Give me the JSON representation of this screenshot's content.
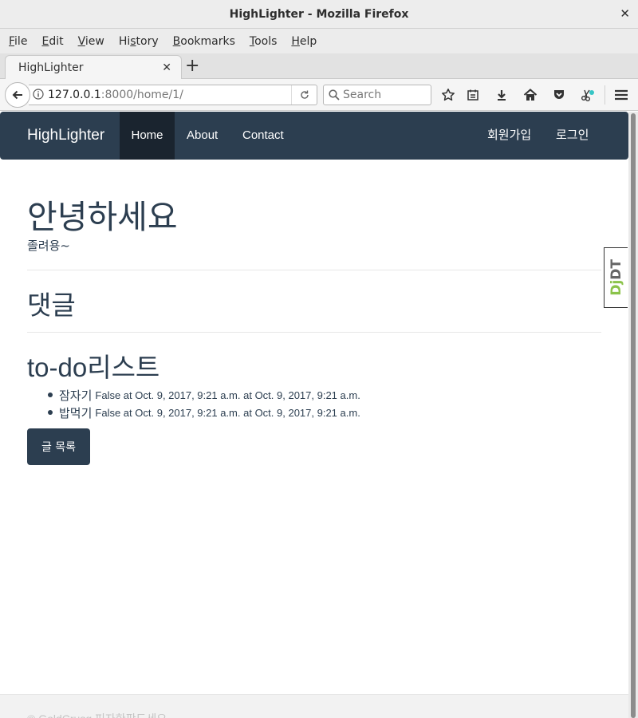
{
  "window": {
    "title": "HighLighter - Mozilla Firefox"
  },
  "menu": {
    "items": [
      {
        "label_pre": "",
        "label_u": "F",
        "label_post": "ile"
      },
      {
        "label_pre": "",
        "label_u": "E",
        "label_post": "dit"
      },
      {
        "label_pre": "",
        "label_u": "V",
        "label_post": "iew"
      },
      {
        "label_pre": "Hi",
        "label_u": "s",
        "label_post": "tory"
      },
      {
        "label_pre": "",
        "label_u": "B",
        "label_post": "ookmarks"
      },
      {
        "label_pre": "",
        "label_u": "T",
        "label_post": "ools"
      },
      {
        "label_pre": "",
        "label_u": "H",
        "label_post": "elp"
      }
    ]
  },
  "tab": {
    "title": "HighLighter"
  },
  "urlbar": {
    "host": "127.0.0.1",
    "rest": ":8000/home/1/"
  },
  "search": {
    "placeholder": "Search"
  },
  "site": {
    "brand": "HighLighter",
    "nav": {
      "home": "Home",
      "about": "About",
      "contact": "Contact",
      "signup": "회원가입",
      "login": "로그인"
    },
    "greeting": "안녕하세요",
    "subtitle": "졸려용~",
    "comments_heading": "댓글",
    "todo_heading": "to-do리스트",
    "todos": [
      {
        "name": "잠자기",
        "meta": "False at Oct. 9, 2017, 9:21 a.m. at Oct. 9, 2017, 9:21 a.m."
      },
      {
        "name": "밥먹기",
        "meta": "False at Oct. 9, 2017, 9:21 a.m. at Oct. 9, 2017, 9:21 a.m."
      }
    ],
    "list_button": "글 목록",
    "footer": "© GoldCrusg 피자한판드세요"
  },
  "djdt": {
    "dj": "Dj",
    "dt": "DT"
  }
}
